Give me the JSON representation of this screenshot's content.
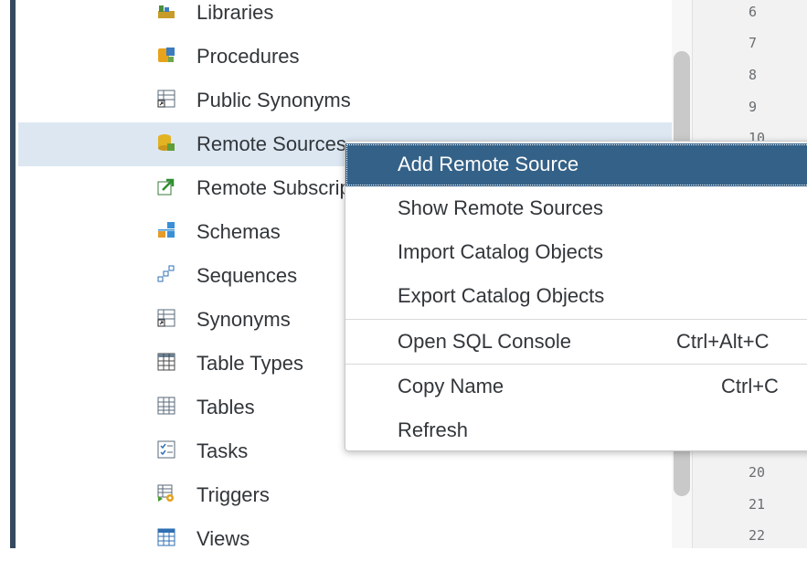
{
  "tree": {
    "items": [
      {
        "label": "Libraries",
        "icon": "library-icon"
      },
      {
        "label": "Procedures",
        "icon": "procedure-icon"
      },
      {
        "label": "Public Synonyms",
        "icon": "public-synonym-icon"
      },
      {
        "label": "Remote Sources",
        "icon": "remote-source-icon",
        "selected": true
      },
      {
        "label": "Remote Subscriptions",
        "icon": "remote-subscription-icon"
      },
      {
        "label": "Schemas",
        "icon": "schema-icon"
      },
      {
        "label": "Sequences",
        "icon": "sequence-icon"
      },
      {
        "label": "Synonyms",
        "icon": "synonym-icon"
      },
      {
        "label": "Table Types",
        "icon": "table-type-icon"
      },
      {
        "label": "Tables",
        "icon": "table-icon"
      },
      {
        "label": "Tasks",
        "icon": "task-icon"
      },
      {
        "label": "Triggers",
        "icon": "trigger-icon"
      },
      {
        "label": "Views",
        "icon": "view-icon"
      }
    ]
  },
  "editor": {
    "line_numbers": [
      "6",
      "7",
      "8",
      "9",
      "10",
      "20",
      "21",
      "22"
    ]
  },
  "context_menu": {
    "items": [
      {
        "label": "Add Remote Source",
        "shortcut": "",
        "active": true
      },
      {
        "label": "Show Remote Sources",
        "shortcut": ""
      },
      {
        "label": "Import Catalog Objects",
        "shortcut": ""
      },
      {
        "label": "Export Catalog Objects",
        "shortcut": ""
      },
      {
        "label": "Open SQL Console",
        "shortcut": "Ctrl+Alt+C"
      },
      {
        "label": "Copy Name",
        "shortcut": "Ctrl+C"
      },
      {
        "label": "Refresh",
        "shortcut": ""
      }
    ]
  },
  "colors": {
    "menu_highlight": "#346187",
    "selected_row": "#dce7f2",
    "left_bar": "#354a5f"
  }
}
